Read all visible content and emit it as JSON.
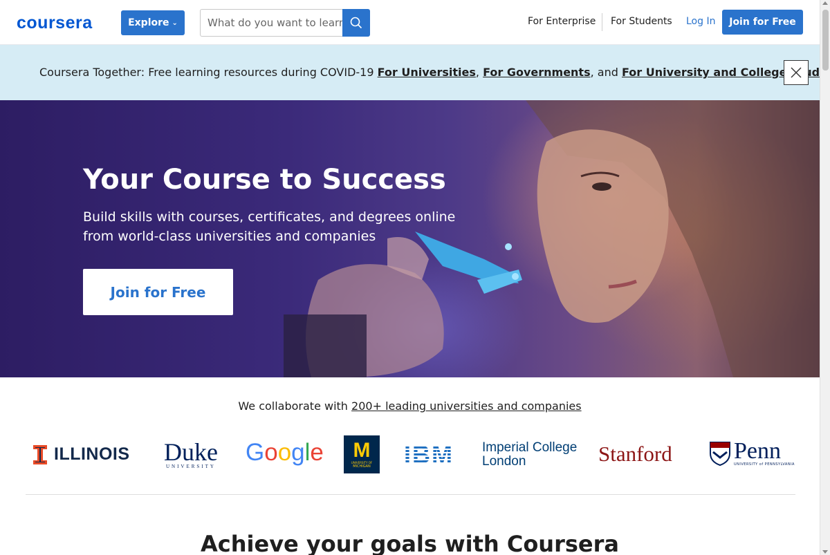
{
  "header": {
    "logo_text": "coursera",
    "explore_label": "Explore",
    "search_placeholder": "What do you want to learn?",
    "nav_enterprise": "For Enterprise",
    "nav_students": "For Students",
    "login_label": "Log In",
    "join_label": "Join for Free"
  },
  "banner": {
    "prefix": "Coursera Together: Free learning resources during COVID-19 ",
    "link_universities": "For Universities",
    "sep1": ", ",
    "link_governments": "For Governments",
    "sep2": ", and ",
    "link_students": "For University and College Students"
  },
  "hero": {
    "title": "Your Course to Success",
    "subtitle": "Build skills with courses, certificates, and degrees online from world-class universities and companies",
    "cta_label": "Join for Free"
  },
  "partners": {
    "intro": "We collaborate with ",
    "intro_link": "200+ leading universities and companies",
    "logos": {
      "illinois": "ILLINOIS",
      "duke": "Duke",
      "duke_sub": "UNIVERSITY",
      "google": [
        "G",
        "o",
        "o",
        "g",
        "l",
        "e"
      ],
      "michigan_m": "M",
      "michigan_sub1": "UNIVERSITY OF",
      "michigan_sub2": "MICHIGAN",
      "ibm": "IBM",
      "imperial_1": "Imperial College",
      "imperial_2": "London",
      "stanford": "Stanford",
      "penn": "Penn",
      "penn_sub": "UNIVERSITY of PENNSYLVANIA"
    }
  },
  "goals_heading": "Achieve your goals with Coursera",
  "colors": {
    "brand_blue": "#0056d2",
    "button_blue": "#2a73cc",
    "banner_bg": "#d6ecf5",
    "illinois_orange": "#e84a27",
    "illinois_blue": "#13294b",
    "duke_blue": "#00205b",
    "michigan_blue": "#00274c",
    "michigan_maize": "#ffcb05",
    "ibm_blue": "#1f70c1",
    "imperial_blue": "#003e74",
    "stanford_red": "#8c1515",
    "penn_blue": "#011f5b"
  }
}
